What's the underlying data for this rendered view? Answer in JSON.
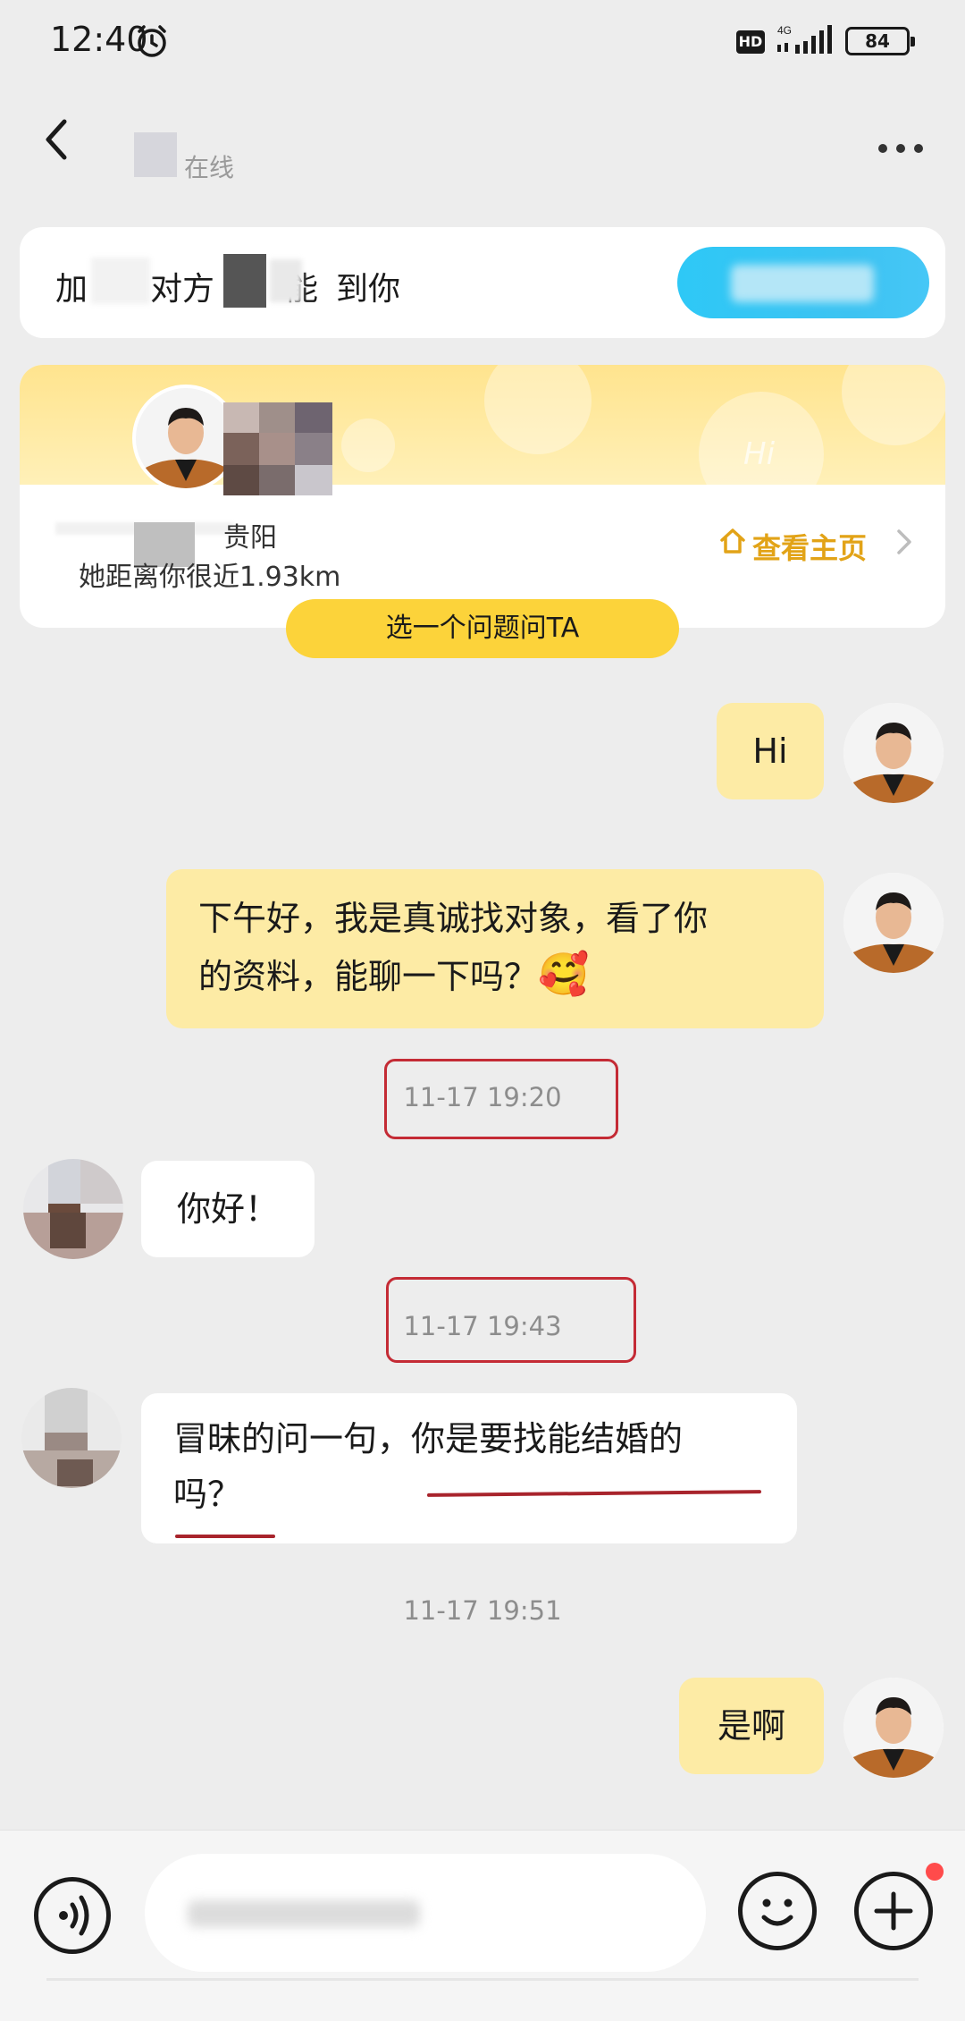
{
  "status_bar": {
    "time": "12:40",
    "hd": "HD",
    "network": "4G",
    "battery": "84"
  },
  "header": {
    "online_status": "在线"
  },
  "add_banner": {
    "text_parts": [
      "加",
      "对方",
      "能",
      "到你"
    ]
  },
  "profile_card": {
    "location": "贵阳",
    "distance": "她距离你很近1.93km",
    "view_homepage": "查看主页",
    "deco_text": "Hi"
  },
  "ask_button": "选一个问题问TA",
  "messages": [
    {
      "sender": "me",
      "text": "Hi"
    },
    {
      "sender": "me",
      "text_line1": "下午好，我是真诚找对象，看了你",
      "text_line2": "的资料，能聊一下吗？",
      "emoji": "🥰"
    },
    {
      "timestamp": "11-17 19:20"
    },
    {
      "sender": "peer",
      "text": "你好！"
    },
    {
      "timestamp": "11-17 19:43"
    },
    {
      "sender": "peer",
      "text_line1": "冒昧的问一句，你是要找能结婚的",
      "text_line2": "吗？"
    },
    {
      "timestamp": "11-17 19:51"
    },
    {
      "sender": "me",
      "text": "是啊"
    }
  ],
  "colors": {
    "my_bubble": "#fdeba5",
    "accent_yellow": "#fcd33a",
    "add_button": "#2ec8f6",
    "highlight_red": "#c42b35"
  }
}
